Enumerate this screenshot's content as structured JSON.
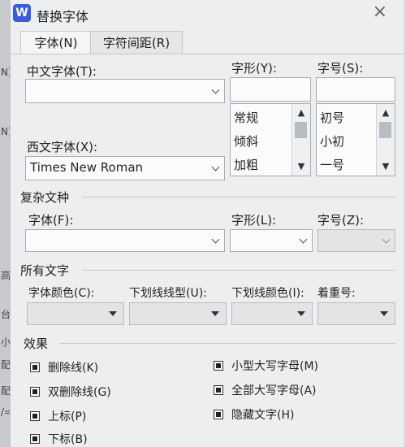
{
  "window": {
    "title": "替换字体",
    "app_icon": "W"
  },
  "background_fragments": [
    "N)",
    "高",
    "台",
    "小",
    "配",
    "配",
    "/="
  ],
  "tabs": [
    {
      "label": "字体(N)",
      "active": true
    },
    {
      "label": "字符间距(R)",
      "active": false
    }
  ],
  "font": {
    "chinese_label": "中文字体(T):",
    "chinese_value": "",
    "western_label": "西文字体(X):",
    "western_value": "Times New Roman",
    "style_label": "字形(Y):",
    "style_value": "",
    "style_options": [
      "常规",
      "倾斜",
      "加粗"
    ],
    "size_label": "字号(S):",
    "size_value": "",
    "size_options": [
      "初号",
      "小初",
      "一号"
    ]
  },
  "complex": {
    "section_label": "复杂文种",
    "font_label": "字体(F):",
    "style_label": "字形(L):",
    "size_label": "字号(Z):"
  },
  "all_text": {
    "section_label": "所有文字",
    "color_label": "字体颜色(C):",
    "underline_type_label": "下划线线型(U):",
    "underline_color_label": "下划线颜色(I):",
    "emphasis_label": "着重号:"
  },
  "effects": {
    "section_label": "效果",
    "items": [
      {
        "label": "删除线(K)"
      },
      {
        "label": "双删除线(G)"
      },
      {
        "label": "上标(P)"
      },
      {
        "label": "下标(B)"
      },
      {
        "label": "小型大写字母(M)"
      },
      {
        "label": "全部大写字母(A)"
      },
      {
        "label": "隐藏文字(H)"
      }
    ]
  }
}
